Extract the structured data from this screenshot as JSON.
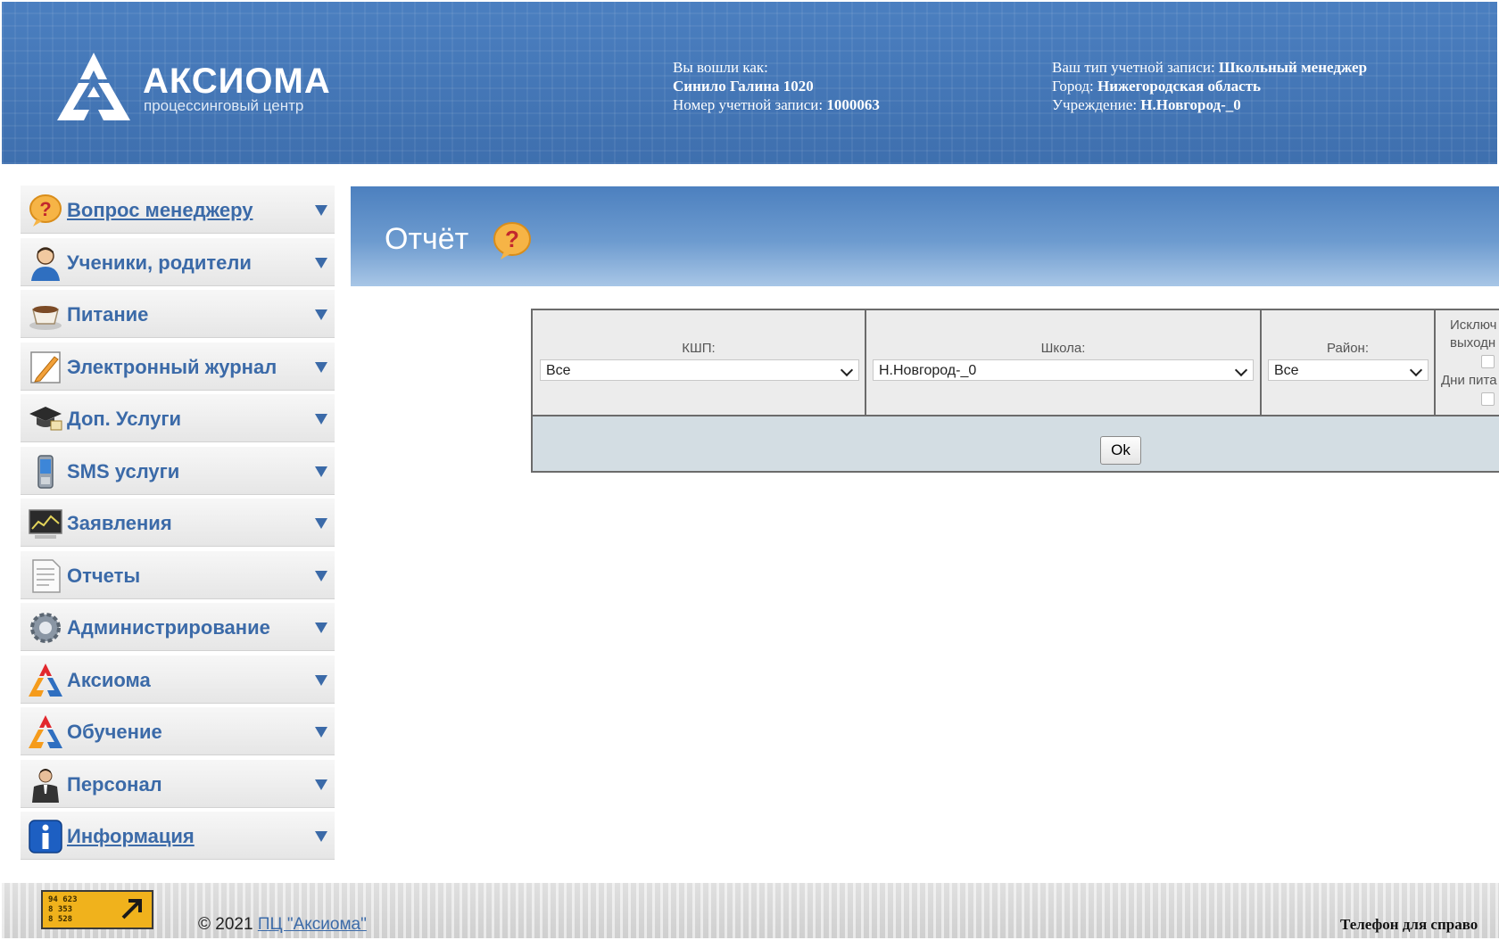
{
  "header": {
    "brand_name": "АКСИОМА",
    "brand_sub": "процессинговый центр",
    "logged_in_label": "Вы вошли как:",
    "user_name": "Синило Галина 1020",
    "account_no_label": "Номер учетной записи:",
    "account_no": "1000063",
    "account_type_label": "Ваш тип учетной записи:",
    "account_type": "Школьный менеджер",
    "city_label": "Город:",
    "city": "Нижегородская область",
    "institution_label": "Учреждение:",
    "institution": "Н.Новгород-_0"
  },
  "sidebar": {
    "items": [
      {
        "label": "Вопрос менеджеру",
        "icon": "question-bubble-icon"
      },
      {
        "label": "Ученики, родители",
        "icon": "person-icon"
      },
      {
        "label": "Питание",
        "icon": "cup-icon"
      },
      {
        "label": "Электронный журнал",
        "icon": "notepad-pencil-icon"
      },
      {
        "label": "Доп. Услуги",
        "icon": "graduation-cap-icon"
      },
      {
        "label": "SMS услуги",
        "icon": "mobile-phone-icon"
      },
      {
        "label": "Заявления",
        "icon": "monitor-chart-icon"
      },
      {
        "label": "Отчеты",
        "icon": "document-icon"
      },
      {
        "label": "Администрирование",
        "icon": "gear-icon"
      },
      {
        "label": "Аксиома",
        "icon": "axioma-logo-icon"
      },
      {
        "label": "Обучение",
        "icon": "axioma-logo-icon"
      },
      {
        "label": "Персонал",
        "icon": "businessman-icon"
      },
      {
        "label": "Информация",
        "icon": "info-icon"
      }
    ]
  },
  "main": {
    "title": "Отчёт",
    "filter": {
      "kshp_label": "КШП:",
      "kshp_value": "Все",
      "school_label": "Школа:",
      "school_value": "Н.Новгород-_0",
      "district_label": "Район:",
      "district_value": "Все",
      "exclude_label_1": "Исключ",
      "exclude_label_2": "выходн",
      "feed_days_label": "Дни пита",
      "ok_label": "Ok"
    }
  },
  "footer": {
    "counter_lines": [
      "94 623",
      "8 353",
      "8 528"
    ],
    "copyright_prefix": "© 2021 ",
    "copyright_link": "ПЦ \"Аксиома\"",
    "phone_label": "Телефон для справо"
  },
  "colors": {
    "header_blue": "#4577b8",
    "menu_text": "#3b6aa8",
    "counter_orange": "#f0b21c"
  }
}
